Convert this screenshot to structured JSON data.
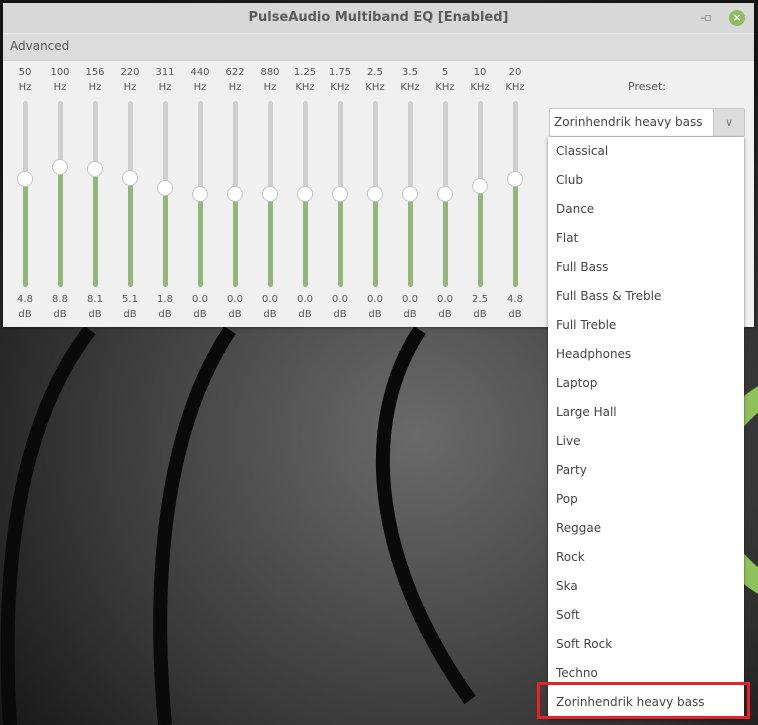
{
  "window": {
    "title": "PulseAudio Multiband EQ [Enabled]",
    "minimize_icon": "minimize-icon",
    "maximize_icon": "maximize-icon",
    "close_icon": "close-icon",
    "accent": "#93b77a"
  },
  "menubar": {
    "advanced": "Advanced"
  },
  "bands": [
    {
      "freq": "50",
      "unit": "Hz",
      "value": 4.8,
      "value_label": "4.8",
      "db": "dB"
    },
    {
      "freq": "100",
      "unit": "Hz",
      "value": 8.8,
      "value_label": "8.8",
      "db": "dB"
    },
    {
      "freq": "156",
      "unit": "Hz",
      "value": 8.1,
      "value_label": "8.1",
      "db": "dB"
    },
    {
      "freq": "220",
      "unit": "Hz",
      "value": 5.1,
      "value_label": "5.1",
      "db": "dB"
    },
    {
      "freq": "311",
      "unit": "Hz",
      "value": 1.8,
      "value_label": "1.8",
      "db": "dB"
    },
    {
      "freq": "440",
      "unit": "Hz",
      "value": 0.0,
      "value_label": "0.0",
      "db": "dB"
    },
    {
      "freq": "622",
      "unit": "Hz",
      "value": 0.0,
      "value_label": "0.0",
      "db": "dB"
    },
    {
      "freq": "880",
      "unit": "Hz",
      "value": 0.0,
      "value_label": "0.0",
      "db": "dB"
    },
    {
      "freq": "1.25",
      "unit": "KHz",
      "value": 0.0,
      "value_label": "0.0",
      "db": "dB"
    },
    {
      "freq": "1.75",
      "unit": "KHz",
      "value": 0.0,
      "value_label": "0.0",
      "db": "dB"
    },
    {
      "freq": "2.5",
      "unit": "KHz",
      "value": 0.0,
      "value_label": "0.0",
      "db": "dB"
    },
    {
      "freq": "3.5",
      "unit": "KHz",
      "value": 0.0,
      "value_label": "0.0",
      "db": "dB"
    },
    {
      "freq": "5",
      "unit": "KHz",
      "value": 0.0,
      "value_label": "0.0",
      "db": "dB"
    },
    {
      "freq": "10",
      "unit": "KHz",
      "value": 2.5,
      "value_label": "2.5",
      "db": "dB"
    },
    {
      "freq": "20",
      "unit": "KHz",
      "value": 4.8,
      "value_label": "4.8",
      "db": "dB"
    }
  ],
  "slider_range_db": [
    -30,
    30
  ],
  "preset": {
    "label": "Preset:",
    "selected": "Zorinhendrik heavy bass",
    "options": [
      "Classical",
      "Club",
      "Dance",
      "Flat",
      "Full Bass",
      "Full Bass & Treble",
      "Full Treble",
      "Headphones",
      "Laptop",
      "Large Hall",
      "Live",
      "Party",
      "Pop",
      "Reggae",
      "Rock",
      "Ska",
      "Soft",
      "Soft Rock",
      "Techno",
      "Zorinhendrik heavy bass"
    ]
  },
  "highlight_color": "#e8202a"
}
